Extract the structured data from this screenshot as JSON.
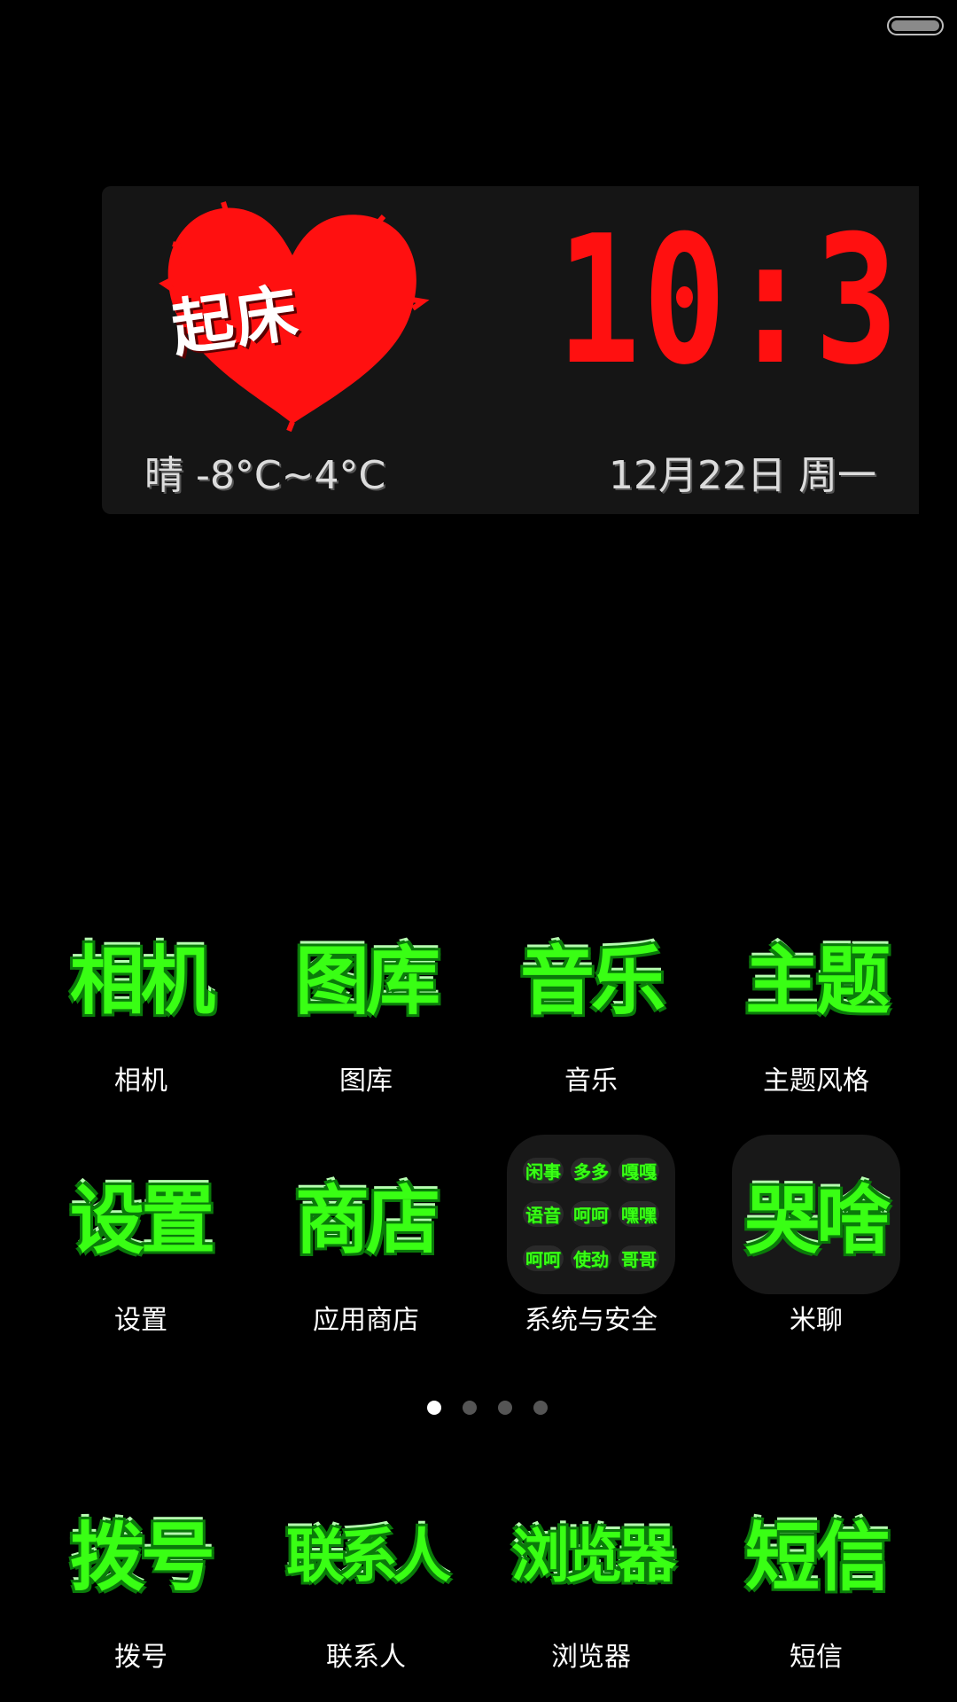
{
  "status_bar": {
    "battery_icon": "battery-icon"
  },
  "widget": {
    "sticker_text": "起床",
    "clock": "10:3",
    "weather": "晴 -8°C~4°C",
    "date": "12月22日  周一",
    "colors": {
      "heart": "#ff1010",
      "clock": "#ff1010"
    }
  },
  "apps": [
    {
      "icon_text": "相机",
      "label": "相机"
    },
    {
      "icon_text": "图库",
      "label": "图库"
    },
    {
      "icon_text": "音乐",
      "label": "音乐"
    },
    {
      "icon_text": "主题",
      "label": "主题风格"
    },
    {
      "icon_text": "设置",
      "label": "设置"
    },
    {
      "icon_text": "商店",
      "label": "应用商店"
    },
    {
      "icon_text": "",
      "label": "系统与安全",
      "folder": [
        "闲事",
        "多多",
        "嘎嘎",
        "语音",
        "呵呵",
        "嘿嘿",
        "呵呵",
        "使劲",
        "哥哥"
      ]
    },
    {
      "icon_text": "哭啥",
      "label": "米聊"
    }
  ],
  "page_indicator": {
    "total": 4,
    "active": 1
  },
  "dock": [
    {
      "icon_text": "拨号",
      "label": "拨号"
    },
    {
      "icon_text": "联系人",
      "label": "联系人"
    },
    {
      "icon_text": "浏览器",
      "label": "浏览器"
    },
    {
      "icon_text": "短信",
      "label": "短信"
    }
  ],
  "theme": {
    "icon_green": "#39ff14",
    "label_white": "#ffffff"
  }
}
